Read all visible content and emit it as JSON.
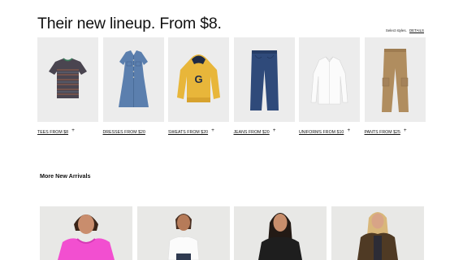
{
  "header": {
    "title": "Their new lineup. From $8.",
    "select_styles": "Select styles.",
    "details_link": "DETAILS"
  },
  "categories": [
    {
      "label": "TEES FROM $8",
      "icon": "tee-shirt-image"
    },
    {
      "label": "DRESSES FROM $20",
      "icon": "denim-dress-image"
    },
    {
      "label": "SWEATS FROM $20",
      "icon": "hoodie-image"
    },
    {
      "label": "JEANS FROM $20",
      "icon": "jeans-image"
    },
    {
      "label": "UNIFORMS FROM $10",
      "icon": "white-shirt-image"
    },
    {
      "label": "PANTS FROM $25",
      "icon": "cargo-pants-image"
    }
  ],
  "more_new_arrivals": {
    "title": "More New Arrivals",
    "items": [
      {
        "icon": "model-pink-hoodie-image"
      },
      {
        "icon": "model-white-tee-image"
      },
      {
        "icon": "model-black-top-image"
      },
      {
        "icon": "model-brown-jacket-image"
      }
    ]
  },
  "colors": {
    "tile_background": "#ececec",
    "text": "#111111"
  }
}
